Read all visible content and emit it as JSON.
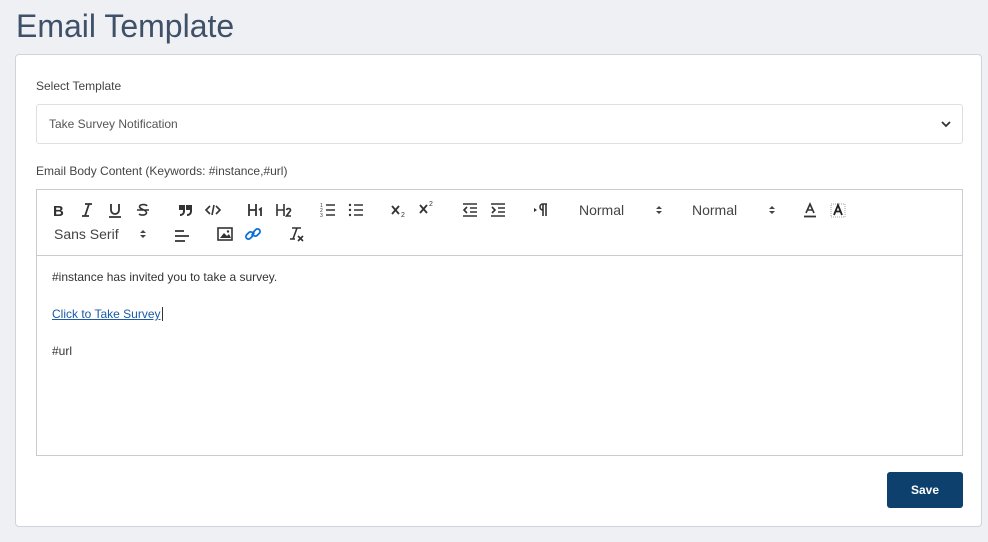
{
  "page": {
    "title": "Email Template"
  },
  "template_select": {
    "label": "Select Template",
    "selected": "Take Survey Notification"
  },
  "editor": {
    "label": "Email Body Content (Keywords: #instance,#url)",
    "toolbar": {
      "header_picker": "Normal",
      "size_picker": "Normal",
      "font_picker": "Sans Serif"
    },
    "content": {
      "line1": "#instance has invited you to take a survey.",
      "link_text": "Click to Take Survey",
      "line3": "#url"
    }
  },
  "actions": {
    "save_label": "Save"
  },
  "colors": {
    "primary": "#0e406d",
    "link": "#1a5aa6",
    "title": "#3f5168",
    "link_icon": "#0a6fd6"
  }
}
